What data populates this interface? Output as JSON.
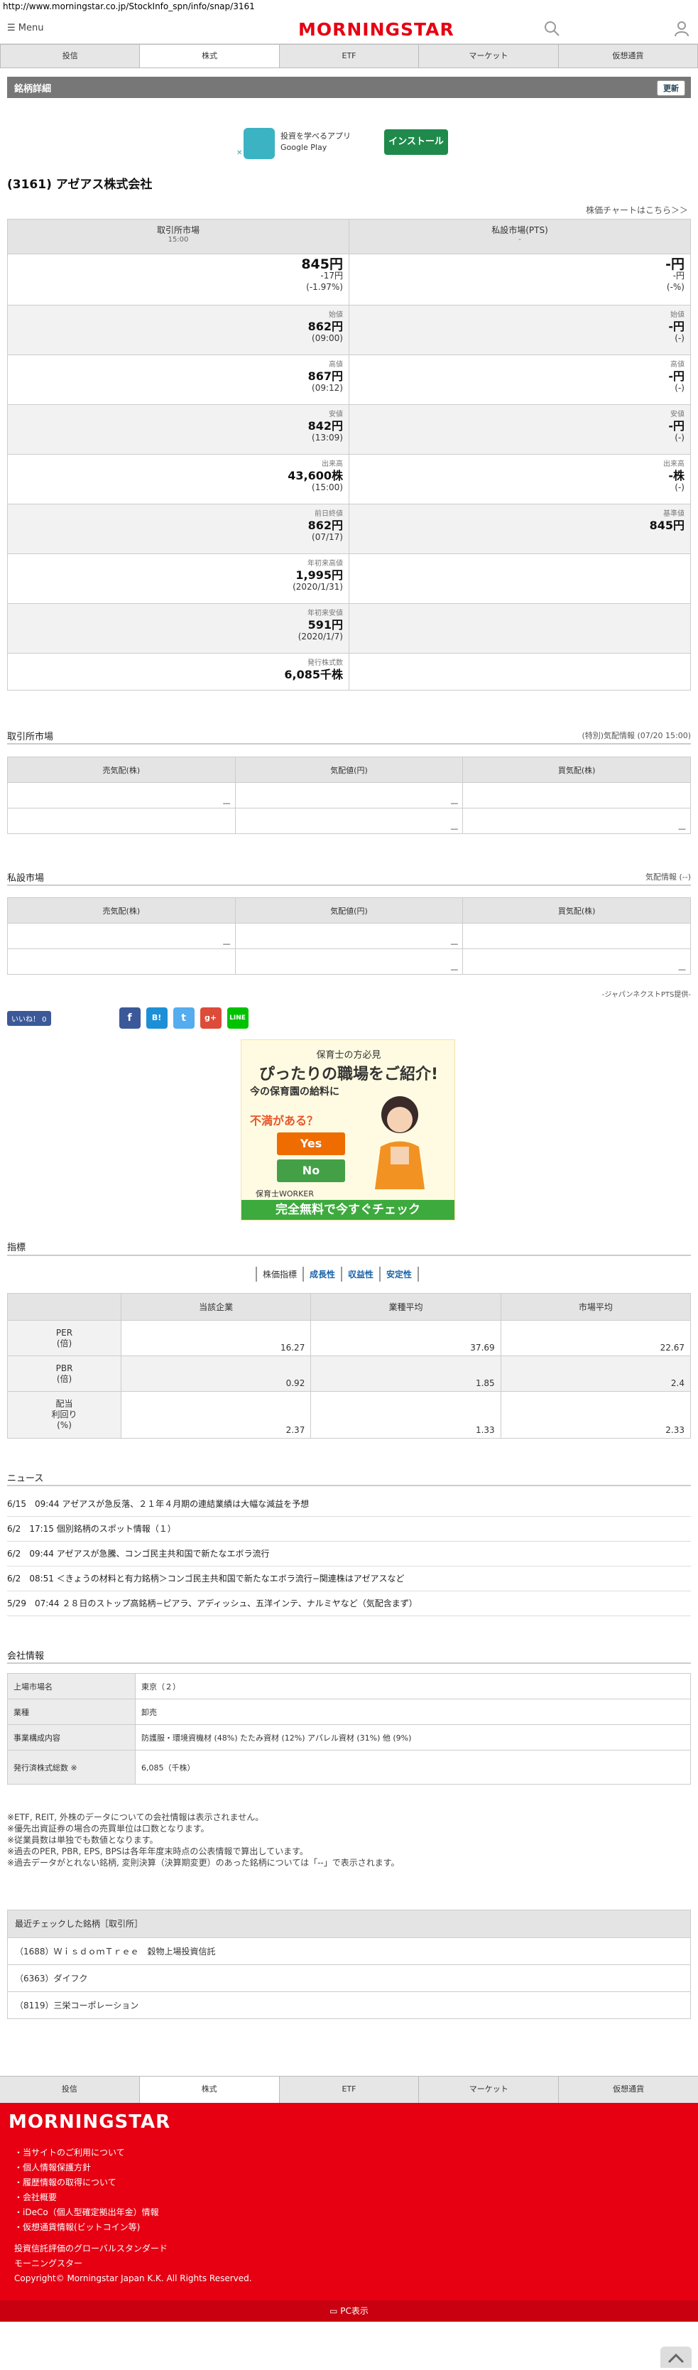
{
  "browser": {
    "url": "http://www.morningstar.co.jp/StockInfo_spn/info/snap/3161"
  },
  "header": {
    "menu_label": "Menu",
    "logo": "MORNINGSTAR"
  },
  "nav_tabs": [
    "投信",
    "株式",
    "ETF",
    "マーケット",
    "仮想通貨"
  ],
  "section": {
    "title": "銘柄詳細",
    "update_label": "更新"
  },
  "app_banner": {
    "line1": "投資を学べるアプリ",
    "line2": "Google Play",
    "install_label": "インストール"
  },
  "stock": {
    "title": "(3161) アゼアス株式会社",
    "chart_link": "株価チャートはこちら＞＞"
  },
  "quote": {
    "exchange_header": "取引所市場",
    "exchange_time": "15:00",
    "pts_header": "私設市場(PTS)",
    "pts_time": "-",
    "price": "845円",
    "change": "-17円",
    "change_pct": "(-1.97%)",
    "pts_price": "-円",
    "pts_change": "-円",
    "pts_change_pct": "(-%)",
    "rows": [
      {
        "label": "始値",
        "value": "862円",
        "sub": "(09:00)",
        "pts_label": "始値",
        "pts_value": "-円",
        "pts_sub": "(-)"
      },
      {
        "label": "高値",
        "value": "867円",
        "sub": "(09:12)",
        "pts_label": "高値",
        "pts_value": "-円",
        "pts_sub": "(-)"
      },
      {
        "label": "安値",
        "value": "842円",
        "sub": "(13:09)",
        "pts_label": "安値",
        "pts_value": "-円",
        "pts_sub": "(-)"
      },
      {
        "label": "出来高",
        "value": "43,600株",
        "sub": "(15:00)",
        "pts_label": "出来高",
        "pts_value": "-株",
        "pts_sub": "(-)"
      },
      {
        "label": "前日終値",
        "value": "862円",
        "sub": "(07/17)",
        "pts_label": "基準値",
        "pts_value": "845円",
        "pts_sub": ""
      },
      {
        "label": "年初来高値",
        "value": "1,995円",
        "sub": "(2020/1/31)",
        "pts_label": "",
        "pts_value": "",
        "pts_sub": ""
      },
      {
        "label": "年初来安値",
        "value": "591円",
        "sub": "(2020/1/7)",
        "pts_label": "",
        "pts_value": "",
        "pts_sub": ""
      },
      {
        "label": "発行株式数",
        "value": "6,085千株",
        "sub": "",
        "pts_label": "",
        "pts_value": "",
        "pts_sub": ""
      }
    ]
  },
  "board_exchange": {
    "title": "取引所市場",
    "note": "(特別)気配情報 (07/20 15:00)",
    "cols": [
      "売気配(株)",
      "気配値(円)",
      "買気配(株)"
    ],
    "dash": "—"
  },
  "board_pts": {
    "title": "私設市場",
    "note": "気配情報 (--)",
    "cols": [
      "売気配(株)",
      "気配値(円)",
      "買気配(株)"
    ],
    "footnote": "-ジャパンネクストPTS提供-"
  },
  "social": {
    "like_label": "いいね！ 0"
  },
  "ad": {
    "top": "保育士の方必見",
    "headline": "ぴったりの職場をご紹介!",
    "q1": "今の保育園の給料に",
    "q2": "不満がある？",
    "yes": "Yes",
    "no": "No",
    "brand": "保育士WORKER",
    "cta": "完全無料で今すぐチェック"
  },
  "indicators": {
    "title": "指標",
    "tabs": [
      "株価指標",
      "成長性",
      "収益性",
      "安定性"
    ],
    "cols": [
      "",
      "当該企業",
      "業種平均",
      "市場平均"
    ],
    "rows": [
      {
        "label": "PER\n(倍)",
        "company": "16.27",
        "industry": "37.69",
        "market": "22.67"
      },
      {
        "label": "PBR\n(倍)",
        "company": "0.92",
        "industry": "1.85",
        "market": "2.4"
      },
      {
        "label": "配当\n利回り\n(%)",
        "company": "2.37",
        "industry": "1.33",
        "market": "2.33"
      }
    ]
  },
  "news": {
    "title": "ニュース",
    "items": [
      "6/15　09:44 アゼアスが急反落、２１年４月期の連結業績は大幅な減益を予想",
      "6/2　17:15 個別銘柄のスポット情報（１）",
      "6/2　09:44 アゼアスが急騰、コンゴ民主共和国で新たなエボラ流行",
      "6/2　08:51 ＜きょうの材料と有力銘柄＞コンゴ民主共和国で新たなエボラ流行−関連株はアゼアスなど",
      "5/29　07:44 ２８日のストップ高銘柄−ピアラ、アディッシュ、五洋インテ、ナルミヤなど（気配含まず）"
    ]
  },
  "company": {
    "title": "会社情報",
    "rows": [
      {
        "k": "上場市場名",
        "v": "東京（２）"
      },
      {
        "k": "業種",
        "v": "卸売"
      },
      {
        "k": "事業構成内容",
        "v": "防護服・環境資機材 (48%) たたみ資材 (12%) アパレル資材 (31%) 他 (9%)"
      },
      {
        "k": "発行済株式総数 ※",
        "v": "6,085（千株）"
      }
    ],
    "notes": [
      "※ETF, REIT, 外株のデータについての会社情報は表示されません。",
      "※優先出資証券の場合の売買単位は口数となります。",
      "※従業員数は単独でも数値となります。",
      "※過去のPER, PBR, EPS, BPSは各年年度末時点の公表情報で算出しています。",
      "※過去データがとれない銘柄, 変則決算（決算期変更）のあった銘柄については「--」で表示されます。"
    ]
  },
  "recent": {
    "title": "最近チェックした銘柄［取引所］",
    "items": [
      "（1688）ＷｉｓｄｏｍＴｒｅｅ　穀物上場投資信託",
      "（6363）ダイフク",
      "（8119）三栄コーポレーション"
    ]
  },
  "footer": {
    "logo": "MORNINGSTAR",
    "links": [
      "・当サイトのご利用について",
      "・個人情報保護方針",
      "・履歴情報の取得について",
      "・会社概要",
      "・iDeCo（個人型確定拠出年金）情報",
      "・仮想通貨情報(ビットコイン等)"
    ],
    "tagline": "投資信託評価のグローバルスタンダード",
    "company": "モーニングスター",
    "copyright": "Copyright© Morningstar Japan K.K. All Rights Reserved.",
    "pc_label": "PC表示"
  }
}
